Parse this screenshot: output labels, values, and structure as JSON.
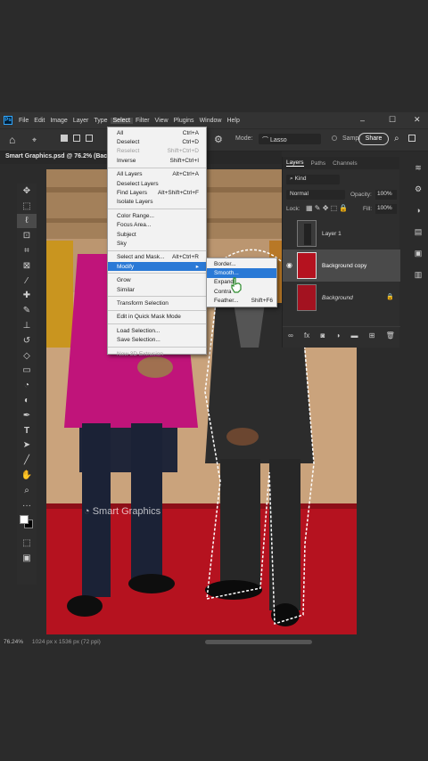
{
  "menubar": {
    "items": [
      "File",
      "Edit",
      "Image",
      "Layer",
      "Type",
      "Select",
      "Filter",
      "View",
      "Plugins",
      "Window",
      "Help"
    ],
    "active_index": 5,
    "logo": "Ps"
  },
  "window_controls": {
    "minimize": "–",
    "maximize": "☐",
    "close": "✕"
  },
  "options": {
    "mode_label": "Mode:",
    "mode_value": "Lasso",
    "sample_label": "Sampl",
    "share_label": "Share"
  },
  "document_tab": "Smart Graphics.psd @ 76.2% (Bac",
  "select_menu": {
    "groups": [
      [
        {
          "label": "All",
          "shortcut": "Ctrl+A",
          "disabled": false
        },
        {
          "label": "Deselect",
          "shortcut": "Ctrl+D",
          "disabled": false
        },
        {
          "label": "Reselect",
          "shortcut": "Shift+Ctrl+D",
          "disabled": true
        },
        {
          "label": "Inverse",
          "shortcut": "Shift+Ctrl+I",
          "disabled": false
        }
      ],
      [
        {
          "label": "All Layers",
          "shortcut": "Alt+Ctrl+A",
          "disabled": false
        },
        {
          "label": "Deselect Layers",
          "shortcut": "",
          "disabled": false
        },
        {
          "label": "Find Layers",
          "shortcut": "Alt+Shift+Ctrl+F",
          "disabled": false
        },
        {
          "label": "Isolate Layers",
          "shortcut": "",
          "disabled": false
        }
      ],
      [
        {
          "label": "Color Range...",
          "shortcut": "",
          "disabled": false
        },
        {
          "label": "Focus Area...",
          "shortcut": "",
          "disabled": false
        },
        {
          "label": "Subject",
          "shortcut": "",
          "disabled": false
        },
        {
          "label": "Sky",
          "shortcut": "",
          "disabled": false
        }
      ],
      [
        {
          "label": "Select and Mask...",
          "shortcut": "Alt+Ctrl+R",
          "disabled": false
        },
        {
          "label": "Modify",
          "shortcut": "▸",
          "disabled": false,
          "highlight": true
        }
      ],
      [
        {
          "label": "Grow",
          "shortcut": "",
          "disabled": false
        },
        {
          "label": "Similar",
          "shortcut": "",
          "disabled": false
        }
      ],
      [
        {
          "label": "Transform Selection",
          "shortcut": "",
          "disabled": false
        }
      ],
      [
        {
          "label": "Edit in Quick Mask Mode",
          "shortcut": "",
          "disabled": false
        }
      ],
      [
        {
          "label": "Load Selection...",
          "shortcut": "",
          "disabled": false
        },
        {
          "label": "Save Selection...",
          "shortcut": "",
          "disabled": false
        }
      ],
      [
        {
          "label": "New 3D Extrusion",
          "shortcut": "",
          "disabled": true
        }
      ]
    ]
  },
  "modify_submenu": {
    "items": [
      {
        "label": "Border...",
        "shortcut": "",
        "highlight": false
      },
      {
        "label": "Smooth...",
        "shortcut": "",
        "highlight": true
      },
      {
        "label": "Expand",
        "shortcut": "",
        "highlight": false
      },
      {
        "label": "Contra",
        "shortcut": "",
        "highlight": false
      },
      {
        "label": "Feather...",
        "shortcut": "Shift+F6",
        "highlight": false
      }
    ]
  },
  "layers_panel": {
    "tabs": [
      "Layers",
      "Paths",
      "Channels"
    ],
    "active_tab": 0,
    "filter_label": "Kind",
    "blend_mode": "Normal",
    "opacity_label": "Opacity:",
    "opacity_value": "100%",
    "lock_label": "Lock:",
    "fill_label": "Fill:",
    "fill_value": "100%",
    "layers": [
      {
        "name": "Layer 1",
        "selected": false,
        "visible": false,
        "locked": false,
        "italic": false
      },
      {
        "name": "Background copy",
        "selected": true,
        "visible": true,
        "locked": false,
        "italic": false
      },
      {
        "name": "Background",
        "selected": false,
        "visible": false,
        "locked": true,
        "italic": true
      }
    ]
  },
  "canvas": {
    "watermark": "Smart Graphics"
  },
  "status": {
    "zoom": "76.24%",
    "doc_info": "1024 px x 1536 px (72 ppi)"
  },
  "colors": {
    "accent": "#2a79d6",
    "carpet": "#b5121f",
    "jacket": "#c0147a"
  }
}
